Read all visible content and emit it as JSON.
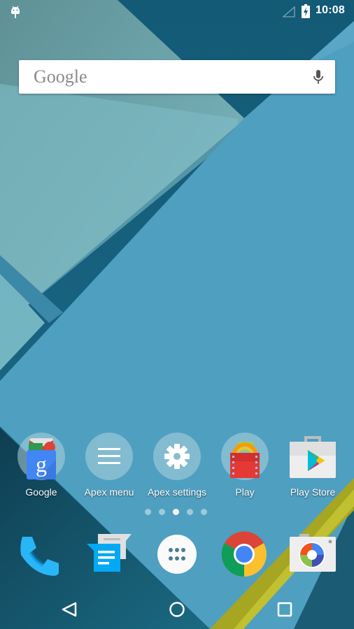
{
  "status_bar": {
    "left_icon": "android-debug-icon",
    "signal_icon": "signal-empty-icon",
    "battery_icon": "battery-charging-icon",
    "time": "10:08"
  },
  "search": {
    "logo_text": "Google",
    "mic_icon": "microphone-icon"
  },
  "home_apps": [
    {
      "label": "Google",
      "icon": "google-folder-icon"
    },
    {
      "label": "Apex menu",
      "icon": "menu-icon"
    },
    {
      "label": "Apex settings",
      "icon": "gear-icon"
    },
    {
      "label": "Play",
      "icon": "play-folder-icon"
    },
    {
      "label": "Play Store",
      "icon": "play-store-icon"
    }
  ],
  "page_indicator": {
    "count": 5,
    "active_index": 2
  },
  "dock": [
    {
      "name": "Phone",
      "icon": "phone-icon"
    },
    {
      "name": "Messenger",
      "icon": "messages-icon"
    },
    {
      "name": "App drawer",
      "icon": "app-drawer-icon"
    },
    {
      "name": "Chrome",
      "icon": "chrome-icon"
    },
    {
      "name": "Camera",
      "icon": "camera-icon"
    }
  ],
  "nav_bar": {
    "back": "back-icon",
    "home": "home-icon",
    "recents": "recents-icon"
  },
  "colors": {
    "wall_light": "#7fbcc6",
    "wall_mid": "#4f9fc0",
    "wall_dark": "#155a72",
    "accent_yellow": "#b8b81c"
  }
}
